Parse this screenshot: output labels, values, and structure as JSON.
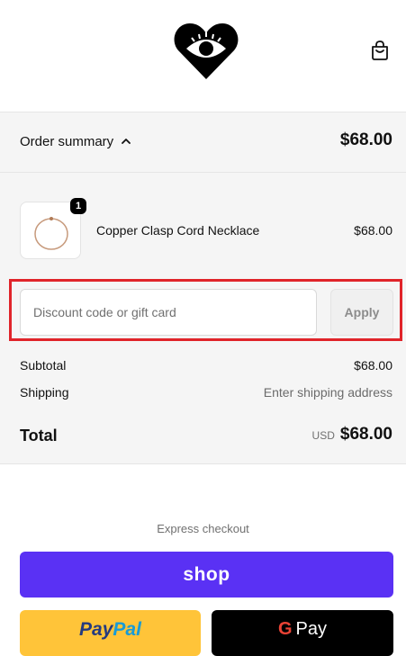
{
  "header": {
    "logo_icon": "heart-eye-logo-icon",
    "cart_icon": "shopping-bag-icon"
  },
  "summary": {
    "toggle_label": "Order summary",
    "toggle_icon": "chevron-up-icon",
    "total": "$68.00"
  },
  "cart": {
    "items": [
      {
        "name": "Copper Clasp Cord Necklace",
        "price": "$68.00",
        "quantity": "1",
        "thumbnail_icon": "necklace-icon"
      }
    ]
  },
  "discount": {
    "placeholder": "Discount code or gift card",
    "value": "",
    "apply_label": "Apply"
  },
  "totals": {
    "subtotal_label": "Subtotal",
    "subtotal_value": "$68.00",
    "shipping_label": "Shipping",
    "shipping_value": "Enter shipping address",
    "total_label": "Total",
    "currency": "USD",
    "total_value": "$68.00"
  },
  "express": {
    "heading": "Express checkout",
    "shop_label": "shop",
    "paypal_label_pay": "Pay",
    "paypal_label_pal": "Pal",
    "gpay_g": "G",
    "gpay_label": "Pay"
  },
  "colors": {
    "accent": "#5a31f4",
    "highlight_border": "#e0242a",
    "paypal": "#ffc439",
    "gpay": "#000000"
  }
}
